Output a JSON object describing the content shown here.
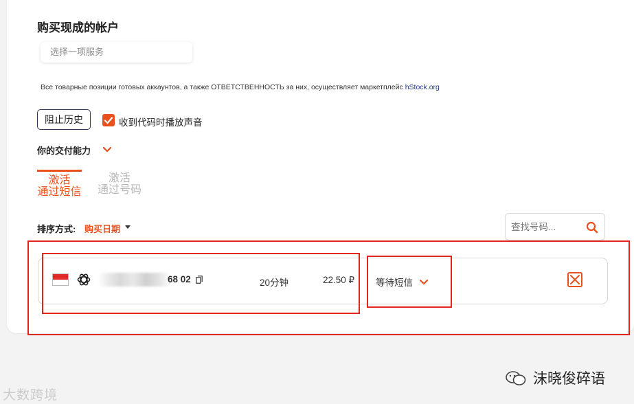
{
  "page": {
    "title": "购买现成的帐户",
    "service_select": {
      "placeholder": "选择一项服务"
    },
    "notice": {
      "text": "Все товарные позиции готовых аккаунтов, а также ОТВЕТСТВЕННОСТЬ за них, осуществляет маркетплейс ",
      "link": "hStock.org"
    },
    "history_button": "阻止历史",
    "sound_checkbox": {
      "label": "收到代码时播放声音",
      "checked": true
    },
    "delivery_capability": "你的交付能力",
    "tabs": [
      {
        "line1": "激活",
        "line2": "通过短信",
        "active": true
      },
      {
        "line1": "激活",
        "line2": "通过号码",
        "active": false
      }
    ],
    "sort": {
      "label": "排序方式:",
      "value": "购买日期"
    },
    "search": {
      "placeholder": "查找号码..."
    },
    "orders": [
      {
        "country_flag": "indonesia-flag",
        "service_icon": "openai-icon",
        "number_visible_tail": "68 02",
        "duration": "20分钟",
        "price": "22.50 ₽",
        "status": "等待短信"
      }
    ]
  },
  "watermarks": {
    "left": "大数跨境",
    "right": "沫晓俊碎语"
  },
  "colors": {
    "accent": "#e8511c",
    "highlight_box": "#e2261f",
    "link": "#1e3a8a"
  }
}
